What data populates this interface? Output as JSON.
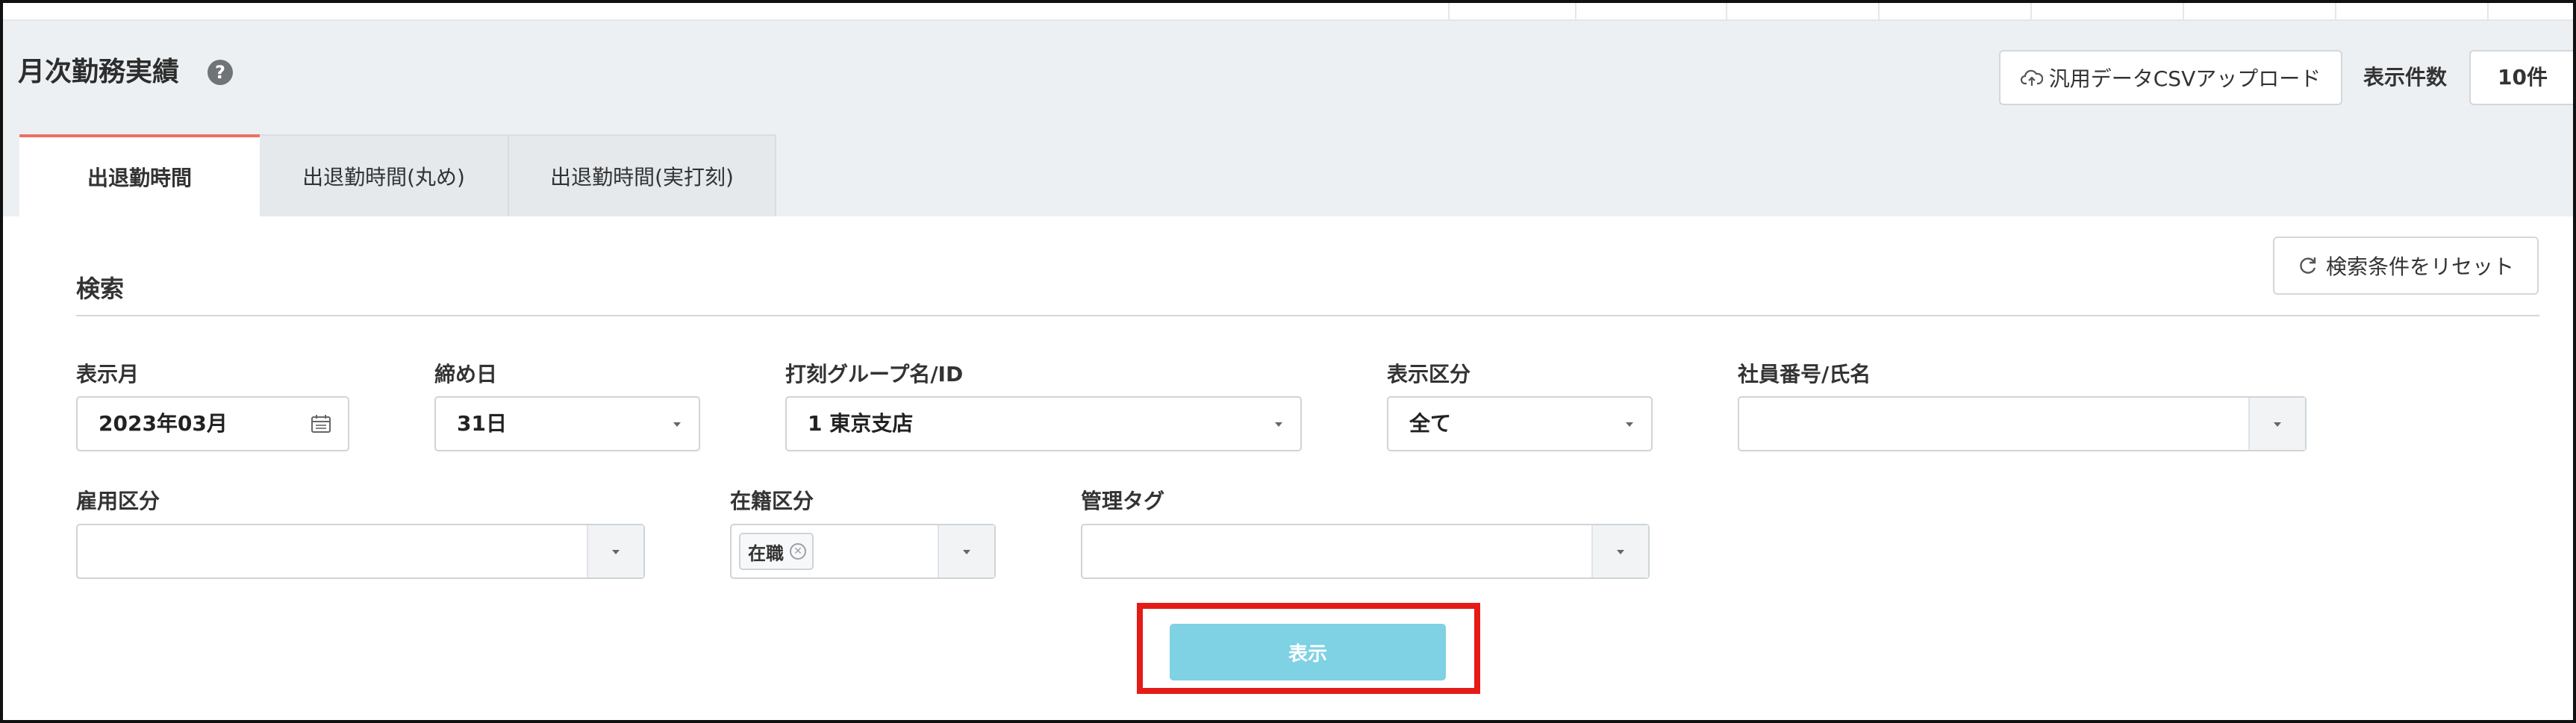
{
  "header": {
    "title": "月次勤務実績",
    "help_symbol": "?",
    "csv_upload_label": "汎用データCSVアップロード",
    "count_label": "表示件数",
    "count_value": "10件"
  },
  "tabs": [
    {
      "label": "出退勤時間",
      "active": true
    },
    {
      "label": "出退勤時間(丸め)",
      "active": false
    },
    {
      "label": "出退勤時間(実打刻)",
      "active": false
    }
  ],
  "search": {
    "title": "検索",
    "reset_label": "検索条件をリセット",
    "fields": {
      "month": {
        "label": "表示月",
        "value": "2023年03月"
      },
      "closing_day": {
        "label": "締め日",
        "value": "31日"
      },
      "group": {
        "label": "打刻グループ名/ID",
        "value": "1 東京支店"
      },
      "display_type": {
        "label": "表示区分",
        "value": "全て"
      },
      "employee": {
        "label": "社員番号/氏名",
        "value": ""
      },
      "employment_type": {
        "label": "雇用区分",
        "value": ""
      },
      "enrollment": {
        "label": "在籍区分",
        "tag": "在職"
      },
      "management_tag": {
        "label": "管理タグ",
        "value": ""
      }
    },
    "submit_label": "表示"
  },
  "colors": {
    "header_bg": "#edf0f2",
    "active_tab_accent": "#ef6f63",
    "submit_button": "#7fd1e4",
    "highlight": "#e41b17"
  }
}
